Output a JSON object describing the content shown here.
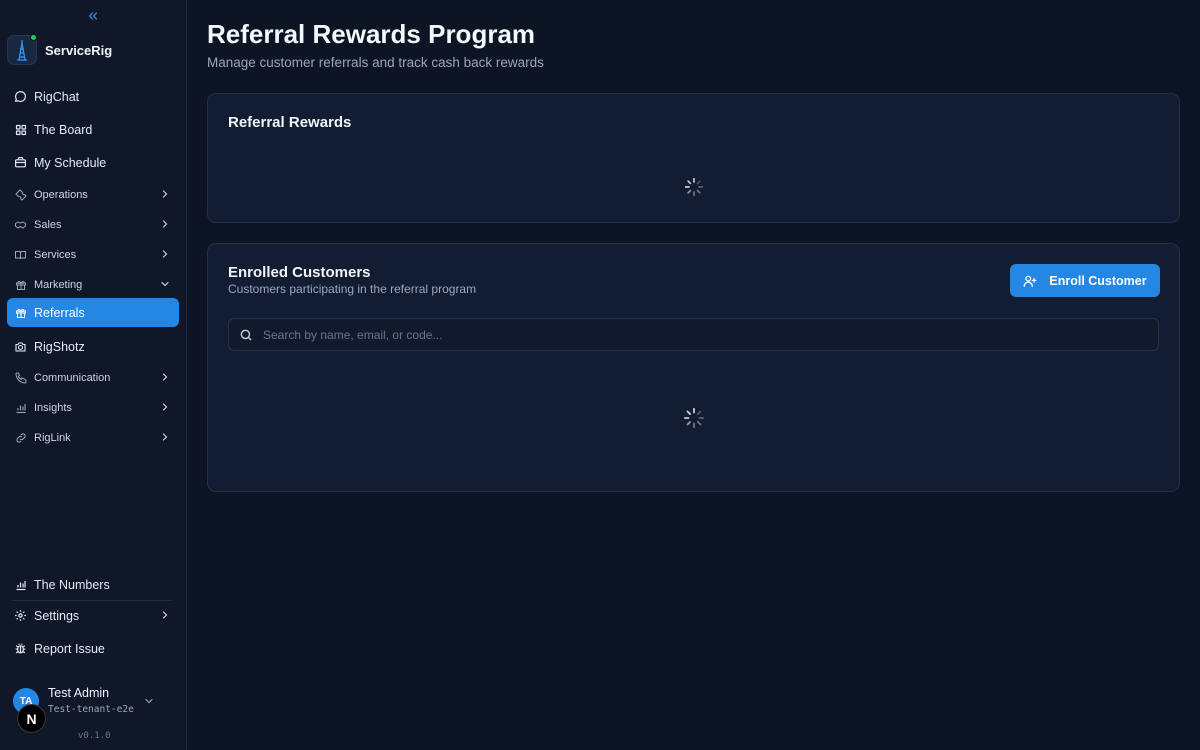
{
  "sidebar": {
    "brand": "ServiceRig",
    "items": [
      {
        "label": "RigChat"
      },
      {
        "label": "The Board"
      },
      {
        "label": "My Schedule"
      },
      {
        "label": "Operations"
      },
      {
        "label": "Sales"
      },
      {
        "label": "Services"
      },
      {
        "label": "Marketing"
      },
      {
        "label": "Referrals"
      },
      {
        "label": "RigShotz"
      },
      {
        "label": "Communication"
      },
      {
        "label": "Insights"
      },
      {
        "label": "RigLink"
      }
    ],
    "bottom_items": [
      {
        "label": "The Numbers"
      },
      {
        "label": "Settings"
      },
      {
        "label": "Report Issue"
      }
    ],
    "user": {
      "initials": "TA",
      "name": "Test Admin",
      "tenant": "Test-tenant-e2e"
    },
    "badge": "N",
    "version": "v0.1.0"
  },
  "page": {
    "title": "Referral Rewards Program",
    "subtitle": "Manage customer referrals and track cash back rewards"
  },
  "rewards_card": {
    "title": "Referral Rewards"
  },
  "customers_card": {
    "title": "Enrolled Customers",
    "subtitle": "Customers participating in the referral program",
    "enroll_label": "Enroll Customer",
    "search_placeholder": "Search by name, email, or code..."
  },
  "colors": {
    "accent": "#2387e3",
    "background": "#0d1424",
    "card": "#131d31",
    "online": "#22c55e"
  }
}
